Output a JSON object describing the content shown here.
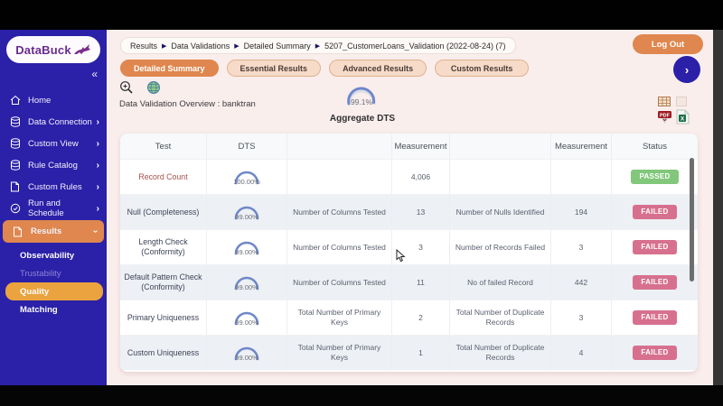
{
  "app": {
    "logo_text": "DataBuck",
    "logout_label": "Log Out"
  },
  "icons": {
    "collapse": "«",
    "chevron_right": "›",
    "breadcrumb_sep": "▶",
    "next": "›"
  },
  "breadcrumb": {
    "items": [
      "Results",
      "Data Validations",
      "Detailed Summary",
      "5207_CustomerLoans_Validation (2022-08-24) (7)"
    ]
  },
  "tabs": [
    {
      "label": "Detailed Summary",
      "active": true
    },
    {
      "label": "Essential Results",
      "active": false
    },
    {
      "label": "Advanced Results",
      "active": false
    },
    {
      "label": "Custom Results",
      "active": false
    }
  ],
  "sidebar": {
    "items": [
      {
        "label": "Home"
      },
      {
        "label": "Data Connection"
      },
      {
        "label": "Custom View"
      },
      {
        "label": "Rule Catalog"
      },
      {
        "label": "Custom Rules"
      },
      {
        "label": "Run and Schedule"
      },
      {
        "label": "Results",
        "active": true
      }
    ],
    "subitems": [
      {
        "label": "Observability"
      },
      {
        "label": "Trustability",
        "dimmed": true
      },
      {
        "label": "Quality",
        "active": true
      },
      {
        "label": "Matching"
      }
    ]
  },
  "overview": {
    "label": "Data Validation Overview : banktran",
    "aggregate_gauge_value": "99.1%",
    "aggregate_gauge_label": "Aggregate DTS"
  },
  "export": {
    "pdf_label": "PDF",
    "excel_label": "X"
  },
  "table": {
    "headers": [
      "Test",
      "DTS",
      "",
      "Measurement",
      "",
      "Measurement",
      "Status"
    ],
    "rows": [
      {
        "test": "Record Count",
        "dts": "100.00%",
        "m1_label": "",
        "m1_value": "4,006",
        "m2_label": "",
        "m2_value": "",
        "status": "PASSED"
      },
      {
        "test": "Null (Completeness)",
        "dts": "99.00%",
        "m1_label": "Number of Columns Tested",
        "m1_value": "13",
        "m2_label": "Number of Nulls Identified",
        "m2_value": "194",
        "status": "FAILED"
      },
      {
        "test": "Length Check (Conformity)",
        "dts": "99.00%",
        "m1_label": "Number of Columns Tested",
        "m1_value": "3",
        "m2_label": "Number of Records Failed",
        "m2_value": "3",
        "status": "FAILED"
      },
      {
        "test": "Default Pattern Check (Conformity)",
        "dts": "99.00%",
        "m1_label": "Number of Columns Tested",
        "m1_value": "11",
        "m2_label": "No of failed Record",
        "m2_value": "442",
        "status": "FAILED"
      },
      {
        "test": "Primary Uniqueness",
        "dts": "99.00%",
        "m1_label": "Total Number of Primary Keys",
        "m1_value": "2",
        "m2_label": "Total Number of Duplicate Records",
        "m2_value": "3",
        "status": "FAILED"
      },
      {
        "test": "Custom Uniqueness",
        "dts": "99.00%",
        "m1_label": "Total Number of Primary Keys",
        "m1_value": "1",
        "m2_label": "Total Number of Duplicate Records",
        "m2_value": "4",
        "status": "FAILED"
      }
    ]
  },
  "colors": {
    "sidebar": "#2b20a8",
    "accent_orange": "#df874e",
    "quality_orange": "#eaa33e",
    "content_bg": "#faeeed",
    "passed": "#82c77b",
    "failed": "#d7708f",
    "gauge_blue": "#6f88c9"
  }
}
